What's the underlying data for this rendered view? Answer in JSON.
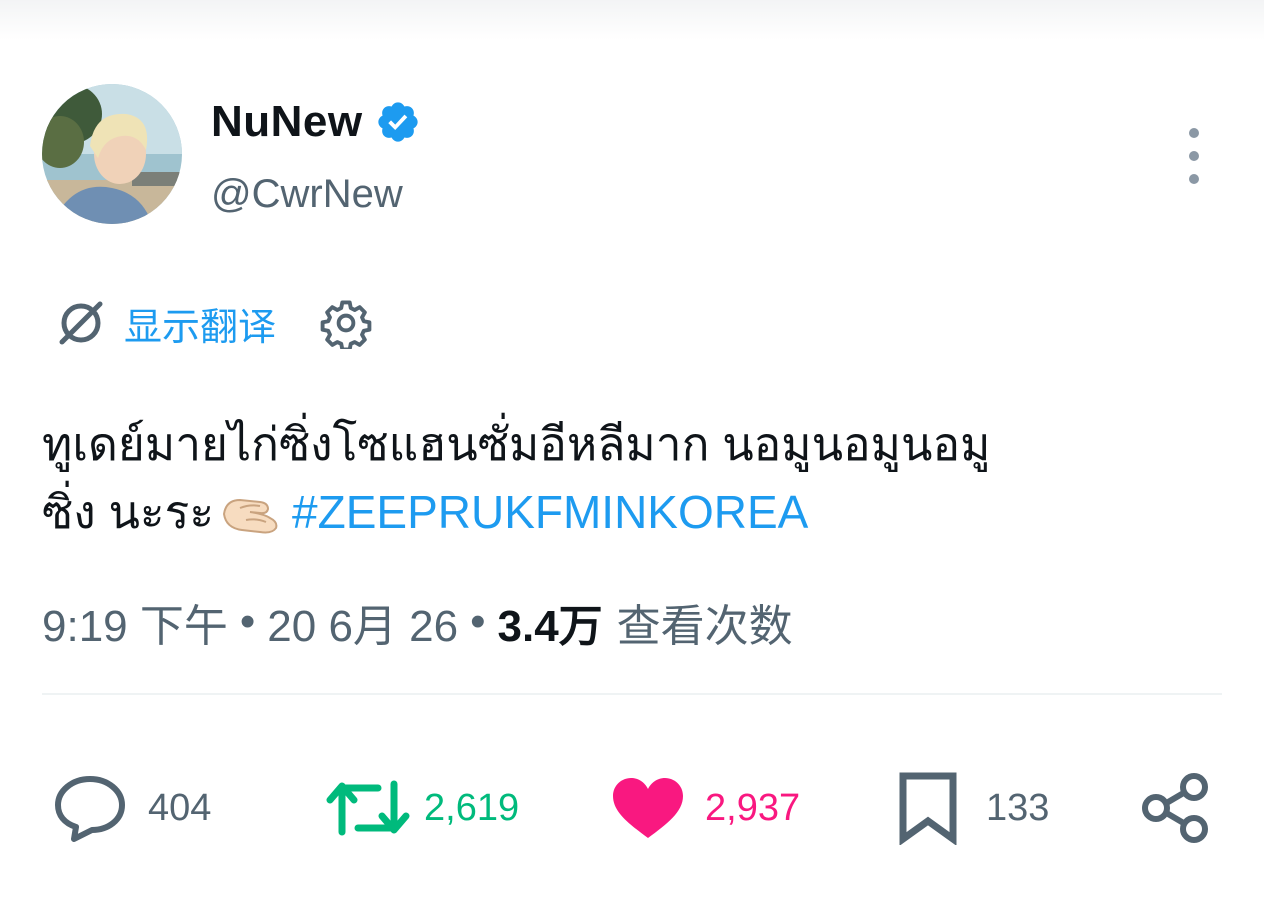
{
  "author": {
    "display_name": "NuNew",
    "handle": "@CwrNew",
    "verified": true,
    "verified_color": "#1d9bf0"
  },
  "icons": {
    "verified": "verified-badge-icon",
    "more": "more-vertical-icon",
    "translate": "translate-icon",
    "settings": "gear-icon",
    "reply": "reply-icon",
    "retweet": "retweet-icon",
    "like": "heart-icon",
    "bookmark": "bookmark-icon",
    "share": "share-icon",
    "emoji": "pinching-hand-emoji"
  },
  "translate": {
    "label": "显示翻译"
  },
  "tweet": {
    "line1": "ทูเดย์มายไก่ซิ่งโซแฮนซั่มอีหลีมาก นอมูนอมูนอมู",
    "line2_text": "ซิ่ง นะระ",
    "hashtag": "#ZEEPRUKFMINKOREA"
  },
  "meta": {
    "time": "9:19 下午",
    "separator": "•",
    "date": "20 6月 26",
    "views_count": "3.4万",
    "views_label": "查看次数"
  },
  "actions": {
    "replies": "404",
    "retweets": "2,619",
    "likes": "2,937",
    "bookmarks": "133"
  },
  "colors": {
    "accent": "#1d9bf0",
    "text_primary": "#0f1419",
    "text_secondary": "#536471",
    "retweet": "#00ba7c",
    "like": "#f91880"
  }
}
